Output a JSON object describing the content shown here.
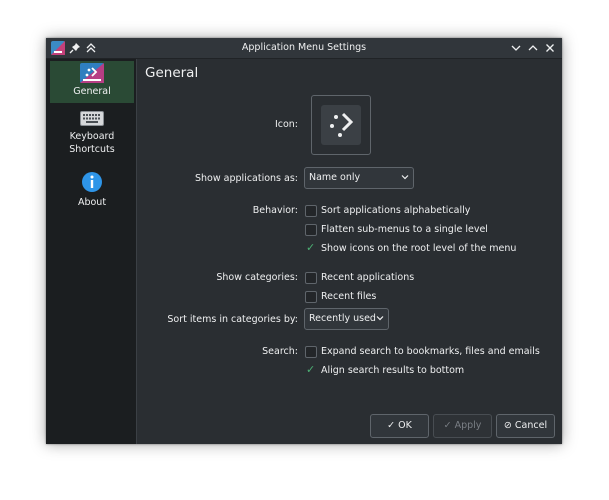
{
  "window": {
    "title": "Application Menu Settings"
  },
  "sidebar": {
    "items": [
      {
        "label": "General",
        "icon": "general-settings-icon"
      },
      {
        "label": "Keyboard",
        "label2": "Shortcuts",
        "icon": "keyboard-icon"
      },
      {
        "label": "About",
        "icon": "info-icon"
      }
    ]
  },
  "page": {
    "title": "General",
    "icon_label": "Icon:",
    "show_apps_label": "Show applications as:",
    "show_apps_value": "Name only",
    "behavior_label": "Behavior:",
    "behavior": [
      {
        "label": "Sort applications alphabetically",
        "checked": false
      },
      {
        "label": "Flatten sub-menus to a single level",
        "checked": false
      },
      {
        "label": "Show icons on the root level of the menu",
        "checked": true
      }
    ],
    "categories_label": "Show categories:",
    "categories": [
      {
        "label": "Recent applications",
        "checked": false
      },
      {
        "label": "Recent files",
        "checked": false
      }
    ],
    "sort_label": "Sort items in categories by:",
    "sort_value": "Recently used",
    "search_label": "Search:",
    "search": [
      {
        "label": "Expand search to bookmarks, files and emails",
        "checked": false
      },
      {
        "label": "Align search results to bottom",
        "checked": true
      }
    ]
  },
  "buttons": {
    "ok": "OK",
    "apply": "Apply",
    "cancel": "Cancel"
  },
  "colors": {
    "accent": "#4caf73",
    "window_bg": "#2a2e32",
    "sidebar_bg": "#1b1e20"
  }
}
